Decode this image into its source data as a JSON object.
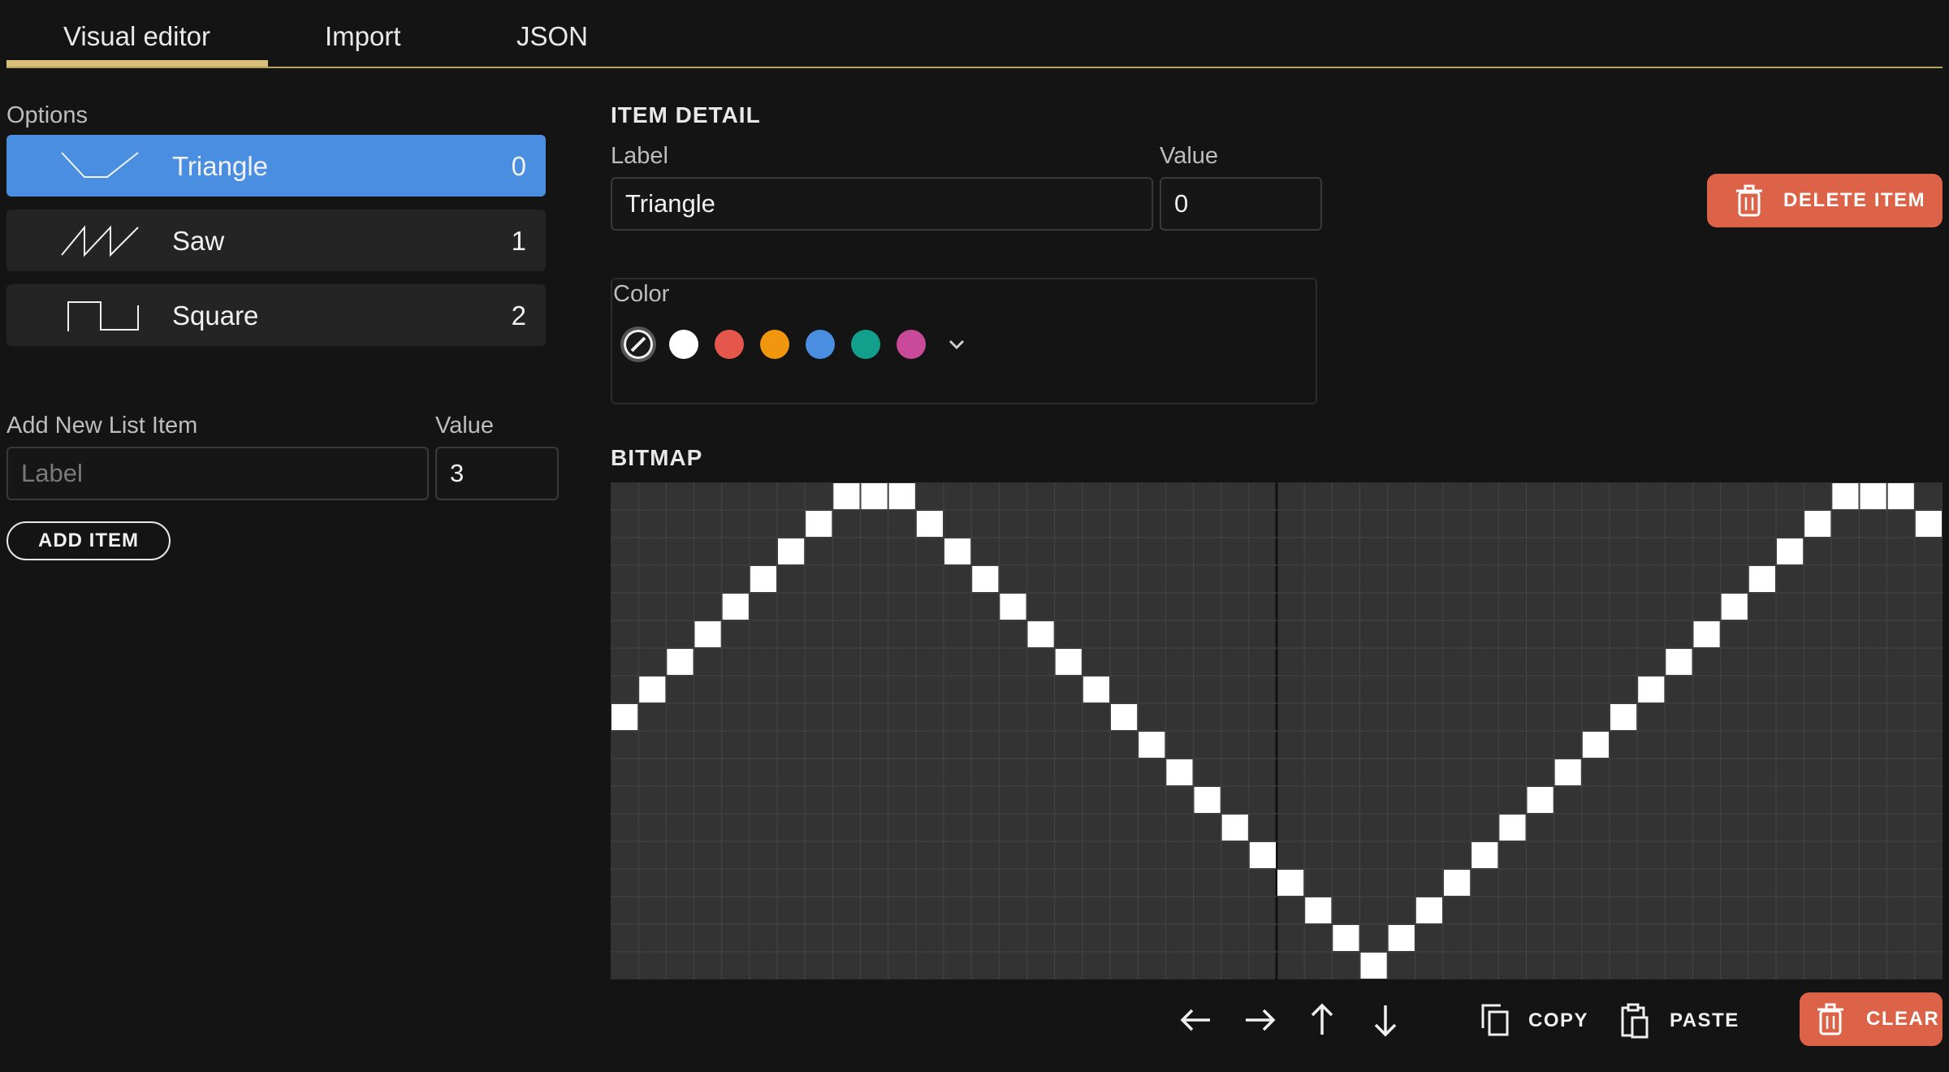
{
  "tabs": [
    {
      "label": "Visual editor",
      "active": true
    },
    {
      "label": "Import",
      "active": false
    },
    {
      "label": "JSON",
      "active": false
    }
  ],
  "options": {
    "title": "Options",
    "items": [
      {
        "icon": "triangle-wave-icon",
        "label": "Triangle",
        "value": "0",
        "selected": true
      },
      {
        "icon": "saw-wave-icon",
        "label": "Saw",
        "value": "1",
        "selected": false
      },
      {
        "icon": "square-wave-icon",
        "label": "Square",
        "value": "2",
        "selected": false
      }
    ]
  },
  "add_item": {
    "label_title": "Add New List Item",
    "label_placeholder": "Label",
    "value_title": "Value",
    "value": "3",
    "button": "ADD ITEM"
  },
  "item_detail": {
    "heading": "ITEM DETAIL",
    "label_title": "Label",
    "label_value": "Triangle",
    "value_title": "Value",
    "value": "0",
    "delete_button": "DELETE ITEM",
    "color_title": "Color",
    "swatches": [
      "none",
      "#ffffff",
      "#e5574b",
      "#f0960f",
      "#4a8ee2",
      "#12a08d",
      "#c94a9a"
    ]
  },
  "bitmap": {
    "heading": "BITMAP",
    "cols": 48,
    "rows": 18,
    "column_heights": [
      9,
      10,
      11,
      12,
      13,
      14,
      15,
      16,
      17,
      18,
      17,
      16,
      15,
      14,
      13,
      12,
      11,
      10,
      9,
      8,
      7,
      6,
      5,
      4,
      3,
      2,
      1,
      0,
      1,
      2,
      3,
      4,
      5,
      6,
      7,
      8,
      9,
      10,
      11,
      12,
      13,
      14,
      15,
      16,
      17,
      18,
      17,
      16
    ],
    "toolbar": {
      "copy": "COPY",
      "paste": "PASTE",
      "clear": "CLEAR"
    }
  },
  "colors": {
    "accent": "#4a8ee2",
    "danger": "#dc6248",
    "tab_underline": "#d8c07a"
  }
}
